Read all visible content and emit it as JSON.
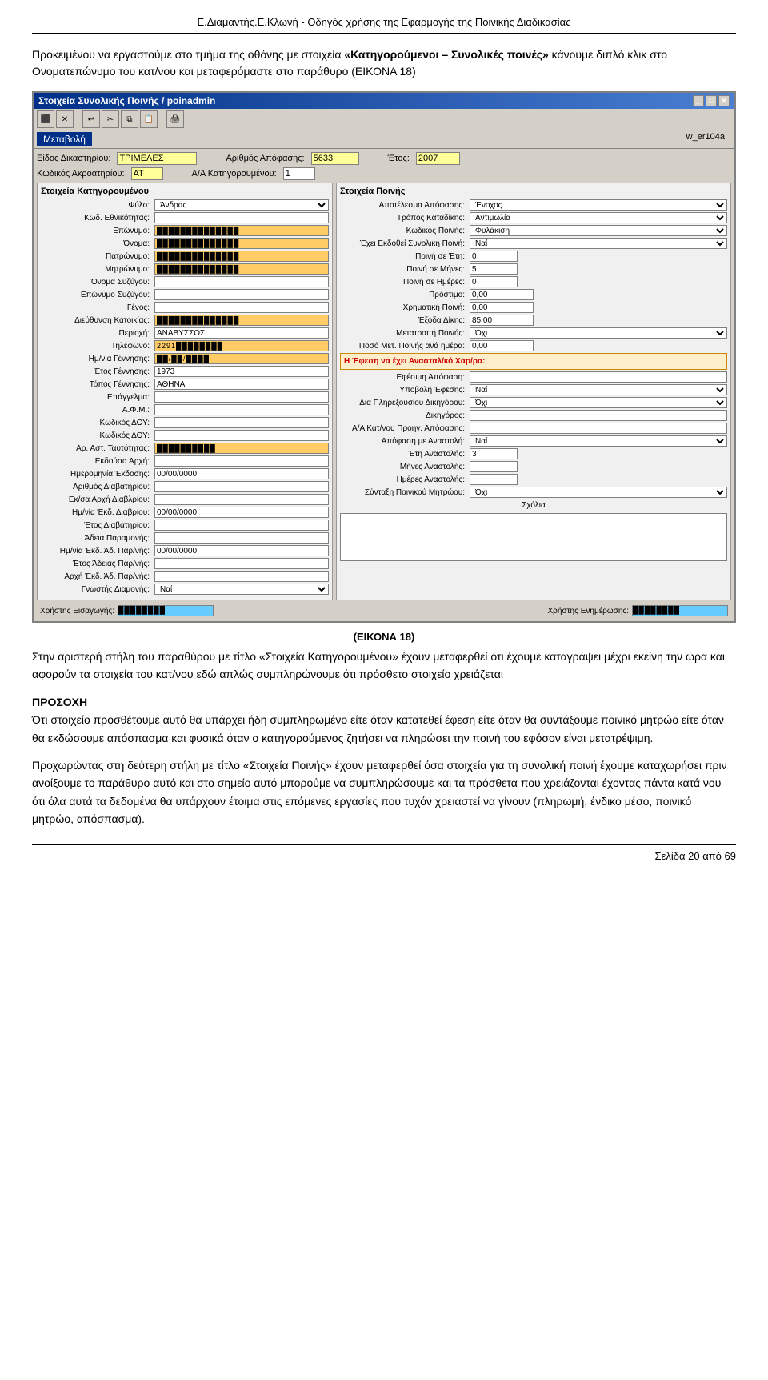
{
  "page": {
    "header": "Ε.Διαμαντής.Ε.Κλωνή - Οδηγός χρήσης της Εφαρμογής της Ποινικής Διαδικασίας",
    "footer": "Σελίδα 20 από 69"
  },
  "intro": {
    "text": "Προκειμένου να εργαστούμε στο τμήμα της οθόνης με στοιχεία «Κατηγορούμενοι – Συνολικές ποινές» κάνουμε διπλό κλικ στο Ονοματεπώνυμο του κατ/νου και μεταφερόμαστε στο παράθυρο (ΕΙΚΟΝΑ 18)"
  },
  "window": {
    "title": "Στοιχεία Συνολικής Ποινής / poinadmin",
    "w_code": "w_er104a",
    "menu": {
      "item": "Μεταβολή"
    },
    "top_fields": {
      "eidos_label": "Είδος Δικαστηρίου:",
      "eidos_value": "ΤΡΙΜΕΛΕΣ",
      "kodikos_label": "Κωδικός Ακροατηρίου:",
      "kodikos_value": "ΑΤ",
      "arithmos_label": "Αριθμός Απόφασης:",
      "arithmos_value": "5633",
      "aa_label": "Α/Α Κατηγορουμένου:",
      "aa_value": "1",
      "etos_label": "Έτος:",
      "etos_value": "2007"
    },
    "left_section_title": "Στοιχεία Κατηγορουμένου",
    "right_section_title": "Στοιχεία Ποινής",
    "left_fields": [
      {
        "label": "Φύλο:",
        "value": "Άνδρας",
        "type": "select"
      },
      {
        "label": "Κωδ. Εθνικότητας:",
        "value": "",
        "type": "input"
      },
      {
        "label": "Επώνυμο:",
        "value": "████████████",
        "type": "masked"
      },
      {
        "label": "Όνομα:",
        "value": "████████████",
        "type": "masked"
      },
      {
        "label": "Πατρώνυμο:",
        "value": "████████████",
        "type": "masked"
      },
      {
        "label": "Μητρώνυμο:",
        "value": "████████████",
        "type": "masked"
      },
      {
        "label": "Όνομα Συζύγου:",
        "value": "",
        "type": "input"
      },
      {
        "label": "Επώνυμο Συζύγου:",
        "value": "",
        "type": "input"
      },
      {
        "label": "Γένος:",
        "value": "",
        "type": "input"
      },
      {
        "label": "Διεύθυνση Κατοικίας:",
        "value": "████████████",
        "type": "masked"
      },
      {
        "label": "Περιοχή:",
        "value": "ΑΝΑΒΥΣΣΟΣ",
        "type": "input"
      },
      {
        "label": "Τηλέφωνο:",
        "value": "2291████████",
        "type": "masked"
      },
      {
        "label": "Ημ/νία Γέννησης:",
        "value": "██/██/████",
        "type": "masked"
      },
      {
        "label": "Έτος Γέννησης:",
        "value": "1973",
        "type": "input"
      },
      {
        "label": "Τόπος Γέννησης:",
        "value": "ΑΘΗΝΑ",
        "type": "input"
      },
      {
        "label": "Επάγγελμα:",
        "value": "",
        "type": "input"
      },
      {
        "label": "Α.Φ.Μ.:",
        "value": "",
        "type": "input"
      },
      {
        "label": "Κωδικός ΔΟΥ:",
        "value": "",
        "type": "input"
      },
      {
        "label": "Κωδικός ΔΟΥ:",
        "value": "",
        "type": "input"
      },
      {
        "label": "Αρ. Αστ. Ταυτότητας:",
        "value": "██████████",
        "type": "masked"
      },
      {
        "label": "Εκδούσα Αρχή:",
        "value": "",
        "type": "input"
      },
      {
        "label": "Ημερομηνία Έκδοσης:",
        "value": "00/00/0000",
        "type": "input"
      },
      {
        "label": "Αριθμός Διαβατηρίου:",
        "value": "",
        "type": "input"
      },
      {
        "label": "Εκ/σα Αρχή Διαβλρίου:",
        "value": "",
        "type": "input"
      },
      {
        "label": "Ημ/νία Έκδ. Διαβρίου:",
        "value": "00/00/0000",
        "type": "input"
      },
      {
        "label": "Έτος Διαβατηρίου:",
        "value": "",
        "type": "input"
      },
      {
        "label": "Άδεια Παραμονής:",
        "value": "",
        "type": "input"
      },
      {
        "label": "Ημ/νία Έκδ. Άδ. Παρ/νής:",
        "value": "00/00/0000",
        "type": "input"
      },
      {
        "label": "Έτος Άδειας Παρ/νής:",
        "value": "",
        "type": "input"
      },
      {
        "label": "Αρχή Έκδ. Άδ. Παρ/νής:",
        "value": "",
        "type": "input"
      },
      {
        "label": "Γνωστής Διαμονής:",
        "value": "Ναί",
        "type": "select"
      }
    ],
    "right_fields": [
      {
        "label": "Αποτέλεσμα Απόφασης:",
        "value": "Ένοχος",
        "type": "select"
      },
      {
        "label": "Τρόπος Καταδίκης:",
        "value": "Αντιμωλία",
        "type": "select"
      },
      {
        "label": "Κωδικός Ποινής:",
        "value": "Φυλάκιση",
        "type": "select"
      },
      {
        "label": "Έχει Εκδοθεί Συνολική Ποινή:",
        "value": "Ναί",
        "type": "select"
      },
      {
        "label": "Ποινή σε Έτη:",
        "value": "0",
        "type": "input"
      },
      {
        "label": "Ποινή σε Μήνες:",
        "value": "5",
        "type": "input"
      },
      {
        "label": "Ποινή σε Ημέρες:",
        "value": "0",
        "type": "input"
      },
      {
        "label": "Πρόστιμο:",
        "value": "0,00",
        "type": "input"
      },
      {
        "label": "Χρηματική Ποινή:",
        "value": "0,00",
        "type": "input"
      },
      {
        "label": "Έξοδα Δίκης:",
        "value": "85,00",
        "type": "input"
      },
      {
        "label": "Μετατροπή Ποινής:",
        "value": "Όχι",
        "type": "select"
      },
      {
        "label": "Ποσό Μετ. Ποινής ανά ημέρα:",
        "value": "0,00",
        "type": "input"
      }
    ],
    "highlight_label": "Η Έφεση να έχει Ανασταλ/κό Χαρ/ρα:",
    "right_fields2": [
      {
        "label": "Εφέσιμη Απόφαση:",
        "value": "",
        "type": "input"
      },
      {
        "label": "Υποβολή Έφεσης:",
        "value": "Ναί",
        "type": "select"
      },
      {
        "label": "Δια Πληρεξουσίου Δικηγόρου:",
        "value": "Όχι",
        "type": "select"
      },
      {
        "label": "Δικηγόρος:",
        "value": "",
        "type": "input"
      },
      {
        "label": "Α/Α Κατ/νου Προηγ. Απόφασης:",
        "value": "",
        "type": "input"
      },
      {
        "label": "Απόφαση με Αναστολή:",
        "value": "Ναί",
        "type": "select"
      },
      {
        "label": "Έτη Αναστολής:",
        "value": "3",
        "type": "input"
      },
      {
        "label": "Μήνες Αναστολής:",
        "value": "",
        "type": "input"
      },
      {
        "label": "Ημέρες Αναστολής:",
        "value": "",
        "type": "input"
      },
      {
        "label": "Σύνταξη Ποινικού Μητρώου:",
        "value": "Όχι",
        "type": "select"
      }
    ],
    "scholia_label": "Σχόλια",
    "bottom": {
      "xristis_eisagogis_label": "Χρήστης Εισαγωγής:",
      "xristis_eisagogis_value": "████████",
      "xristis_enimerwsis_label": "Χρήστης Ενημέρωσης:",
      "xristis_enimerwsis_value": "████████"
    }
  },
  "caption": "(ΕΙΚΟΝΑ 18)",
  "body_text1": "Στην αριστερή στήλη του παραθύρου με τίτλο «Στοιχεία Κατηγορουμένου» έχουν μεταφερθεί ότι έχουμε καταγράψει μέχρι εκείνη την ώρα και αφορούν τα στοιχεία του κατ/νου εδώ απλώς συμπληρώνουμε ότι πρόσθετο στοιχείο χρειάζεται",
  "note": {
    "title": "ΠΡΟΣΟΧΗ",
    "text": "Ότι στοιχείο προσθέτουμε αυτό θα υπάρχει ήδη συμπληρωμένο είτε όταν κατατεθεί έφεση είτε όταν θα συντάξουμε ποινικό μητρώο είτε όταν θα εκδώσουμε απόσπασμα και φυσικά όταν ο κατηγορούμενος ζητήσει να πληρώσει την ποινή του εφόσον είναι μετατρέψιμη."
  },
  "body_text2": "Προχωρώντας στη δεύτερη στήλη με τίτλο «Στοιχεία Ποινής» έχουν μεταφερθεί όσα στοιχεία για τη συνολική ποινή έχουμε καταχωρήσει πριν ανοίξουμε το παράθυρο αυτό και στο σημείο αυτό μπορούμε να συμπληρώσουμε και τα πρόσθετα που χρειάζονται έχοντας πάντα κατά νου ότι όλα αυτά τα δεδομένα θα υπάρχουν έτοιμα στις επόμενες εργασίες που τυχόν χρειαστεί να γίνουν (πληρωμή, ένδικο μέσο, ποινικό μητρώο, απόσπασμα)."
}
